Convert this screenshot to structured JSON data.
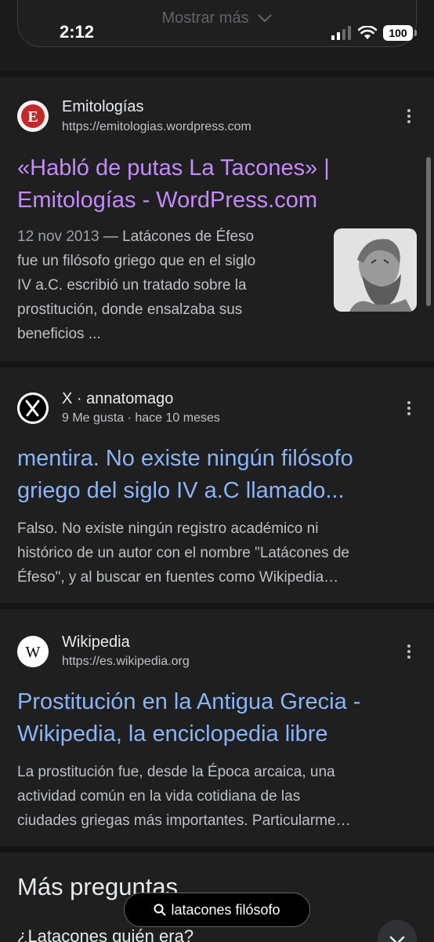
{
  "status_bar": {
    "time": "2:12",
    "battery": "100"
  },
  "top": {
    "show_more_label": "Mostrar más"
  },
  "results": [
    {
      "site_name": "Emitologías",
      "site_url": "https://emitologias.wordpress.com",
      "title_line1": "«Habló de putas La Tacones» |",
      "title_line2": "Emitologías - WordPress.com",
      "snippet_date": "12 nov 2013",
      "snippet_line1": " — Latácones de Éfeso",
      "snippet_line2": "fue un filósofo griego que en el siglo",
      "snippet_line3": "IV a.C. escribió un tratado sobre la",
      "snippet_line4": "prostitución, donde ensalzaba sus",
      "snippet_line5": "beneficios ...",
      "title_color": "#c58af9"
    },
    {
      "site_name": "X · annatomago",
      "site_url": "9 Me gusta · hace 10 meses",
      "title_line1": "mentira. No existe ningún filósofo",
      "title_line2": "griego del siglo IV a.C llamado...",
      "snippet_line1": "Falso. No existe ningún registro académico ni",
      "snippet_line2": "histórico de un autor con el nombre \"Latácones de",
      "snippet_line3": "Éfeso\", y al buscar en fuentes como Wikipedia…",
      "title_color": "#8ab4f8"
    },
    {
      "site_name": "Wikipedia",
      "site_url": "https://es.wikipedia.org",
      "title_line1": "Prostitución en la Antigua Grecia -",
      "title_line2": "Wikipedia, la enciclopedia libre",
      "snippet_line1": "La prostitución fue, desde la Época arcaica, una",
      "snippet_line2": "actividad común en la vida cotidiana de las",
      "snippet_line3": "ciudades griegas más importantes. Particularme…",
      "title_color": "#8ab4f8"
    }
  ],
  "more_questions": {
    "title": "Más preguntas",
    "first_question": "¿Latacones quién era?"
  },
  "search_pill": {
    "query": "latacones filósofo"
  },
  "logos": {
    "emitologias_letter": "E",
    "x_letter": "X",
    "wikipedia_letter": "W"
  }
}
